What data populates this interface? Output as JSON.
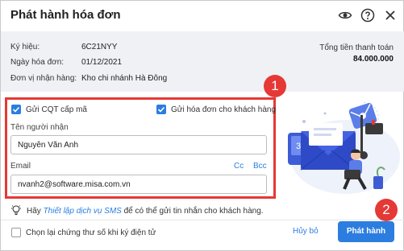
{
  "dialog": {
    "title": "Phát hành hóa đơn",
    "icons": [
      "eye-icon",
      "help-icon",
      "close-icon"
    ]
  },
  "summary": {
    "symbol_label": "Ký hiệu:",
    "symbol_value": "6C21NYY",
    "date_label": "Ngày hóa đơn:",
    "date_value": "01/12/2021",
    "unit_label": "Đơn vị nhận hàng:",
    "unit_value": "Kho chi nhánh Hà Đông",
    "total_label": "Tổng tiền thanh toán",
    "total_value": "84.000.000"
  },
  "form": {
    "send_cqt_label": "Gửi CQT cấp mã",
    "send_cqt_checked": true,
    "send_customer_label": "Gửi hóa đơn cho khách hàng",
    "send_customer_checked": true,
    "recipient_label": "Tên người nhận",
    "recipient_value": "Nguyễn Văn Anh",
    "email_label": "Email",
    "cc_label": "Cc",
    "bcc_label": "Bcc",
    "email_value": "nvanh2@software.misa.com.vn"
  },
  "callouts": {
    "badge_1": "1",
    "badge_2": "2"
  },
  "hint": {
    "prefix": "Hãy",
    "link": "Thiết lập dịch vụ SMS",
    "suffix": "để có thể gửi tin nhắn cho khách hàng."
  },
  "footer": {
    "reselect_cert_label": "Chọn lại chứng thư số khi ký điện tử",
    "reselect_cert_checked": false,
    "cancel_label": "Hủy bỏ",
    "issue_label": "Phát hành"
  },
  "colors": {
    "accent": "#2b7de0",
    "highlight": "#e53935",
    "summary_bg": "#f0f1f5"
  }
}
